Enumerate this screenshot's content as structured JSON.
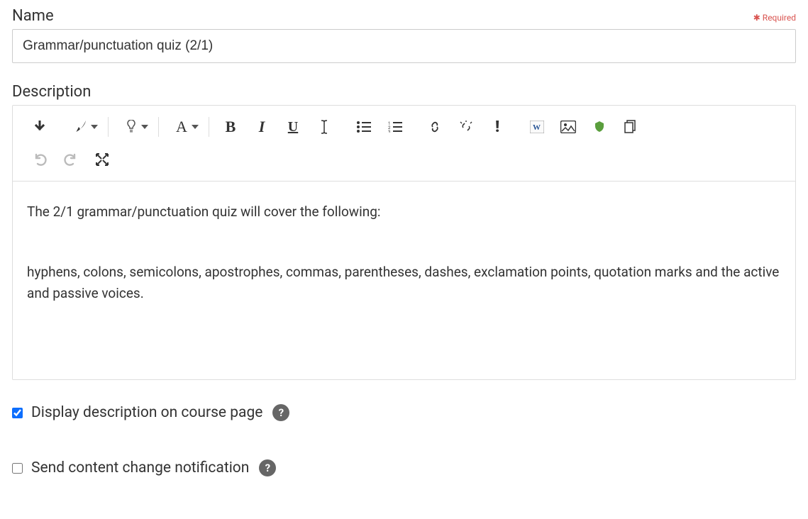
{
  "fields": {
    "name_label": "Name",
    "required_text": "Required",
    "name_value": "Grammar/punctuation quiz (2/1)",
    "description_label": "Description"
  },
  "description": {
    "paragraph1": "The 2/1 grammar/punctuation quiz will cover the following:",
    "paragraph2": "hyphens, colons, semicolons, apostrophes, commas, parentheses, dashes, exclamation points, quotation marks and the active and passive voices."
  },
  "checkboxes": {
    "display_label": "Display description on course page",
    "display_checked": true,
    "notify_label": "Send content change notification",
    "notify_checked": false
  },
  "icons": {
    "help": "?"
  }
}
